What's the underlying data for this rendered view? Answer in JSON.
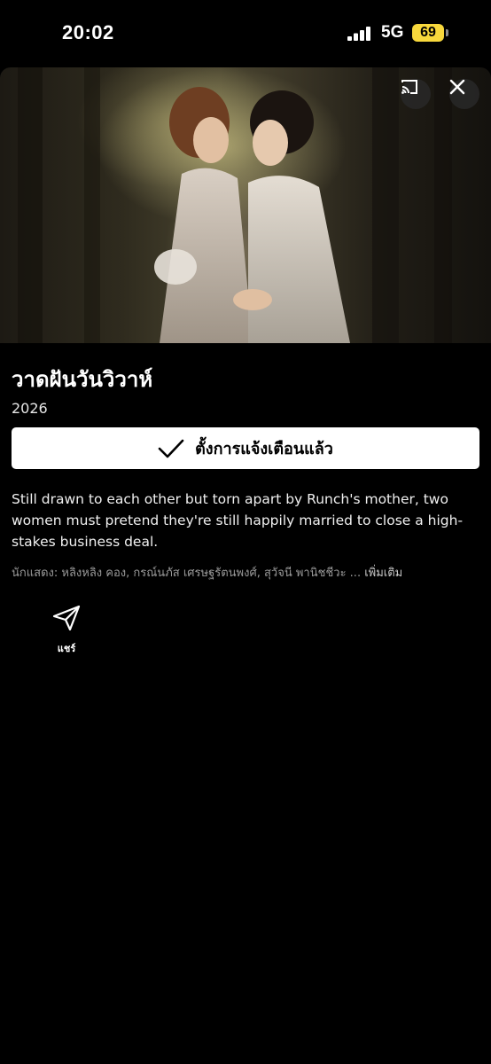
{
  "status_bar": {
    "time": "20:02",
    "network": "5G",
    "battery": "69"
  },
  "hero": {
    "image_alt": "Two women in wedding dresses embracing, foreheads touching, in a forest",
    "cast_icon": "cast-icon",
    "close_icon": "close-icon"
  },
  "title": {
    "name": "วาดฝันวันวิวาห์",
    "year": "2026"
  },
  "actions": {
    "remind_label": "ตั้งการแจ้งเตือนแล้ว",
    "remind_icon": "checkmark-icon",
    "share_label": "แชร์",
    "share_icon": "send-icon"
  },
  "synopsis": "Still drawn to each other but torn apart by Runch's mother, two women must pretend they're still happily married to close a high-stakes business deal.",
  "cast": {
    "label": "นักแสดง: หลิงหลิง คอง, กรณ์นภัส เศรษฐรัตนพงศ์, สุวัจนี พานิชชีวะ ...",
    "more": "เพิ่มเติม"
  }
}
